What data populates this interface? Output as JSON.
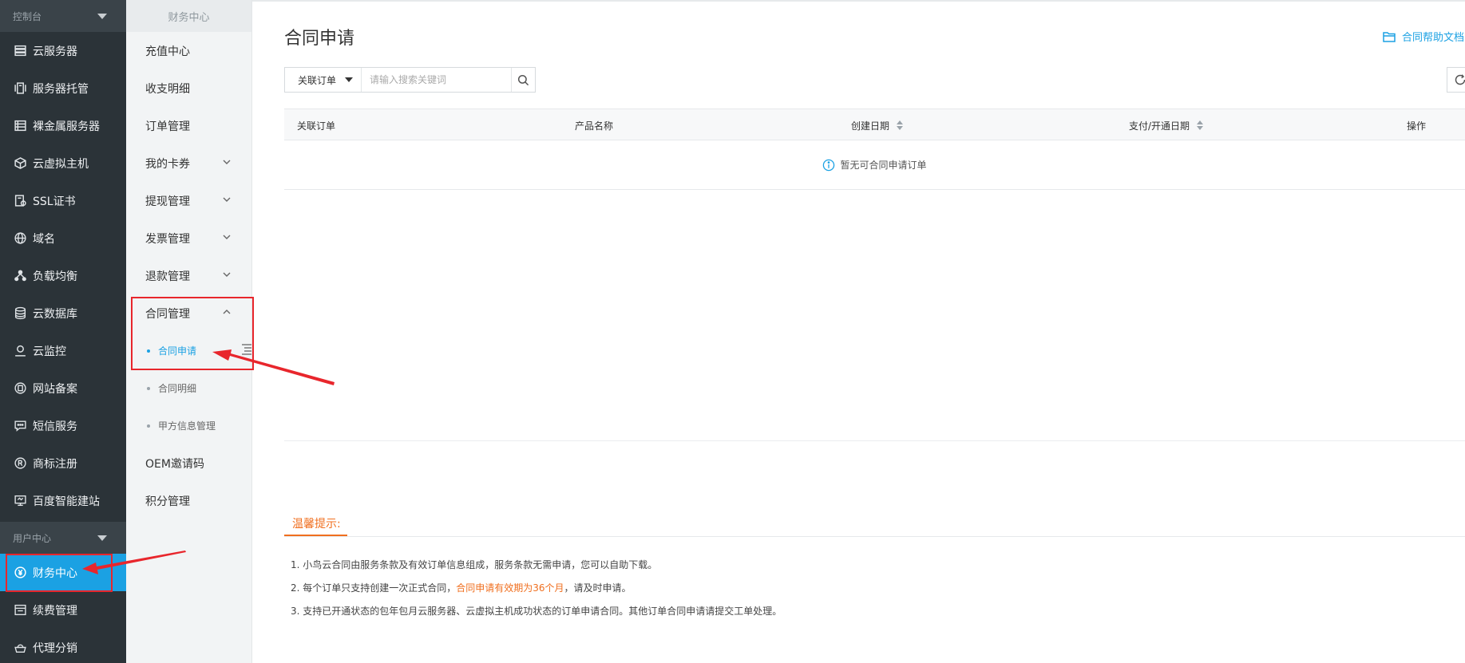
{
  "sidebar": {
    "console_label": "控制台",
    "items": [
      {
        "label": "云服务器",
        "icon": "server-list-icon"
      },
      {
        "label": "服务器托管",
        "icon": "hosting-icon"
      },
      {
        "label": "裸金属服务器",
        "icon": "bare-metal-icon"
      },
      {
        "label": "云虚拟主机",
        "icon": "cube-icon"
      },
      {
        "label": "SSL证书",
        "icon": "certificate-icon"
      },
      {
        "label": "域名",
        "icon": "globe-icon"
      },
      {
        "label": "负载均衡",
        "icon": "load-balance-icon"
      },
      {
        "label": "云数据库",
        "icon": "database-icon"
      },
      {
        "label": "云监控",
        "icon": "monitor-user-icon"
      },
      {
        "label": "网站备案",
        "icon": "record-icon"
      },
      {
        "label": "短信服务",
        "icon": "sms-icon"
      },
      {
        "label": "商标注册",
        "icon": "trademark-icon"
      },
      {
        "label": "百度智能建站",
        "icon": "site-builder-icon"
      }
    ],
    "user_center_label": "用户中心",
    "user_items": [
      {
        "label": "财务中心",
        "icon": "finance-icon",
        "active": true
      },
      {
        "label": "续费管理",
        "icon": "renew-icon"
      },
      {
        "label": "代理分销",
        "icon": "agent-icon"
      }
    ]
  },
  "subnav": {
    "title": "财务中心",
    "items": [
      {
        "label": "充值中心"
      },
      {
        "label": "收支明细"
      },
      {
        "label": "订单管理"
      },
      {
        "label": "我的卡券",
        "expandable": true
      },
      {
        "label": "提现管理",
        "expandable": true
      },
      {
        "label": "发票管理",
        "expandable": true
      },
      {
        "label": "退款管理",
        "expandable": true
      }
    ],
    "contract": {
      "label": "合同管理",
      "children": [
        {
          "label": "合同申请",
          "active": true
        },
        {
          "label": "合同明细"
        },
        {
          "label": "甲方信息管理"
        }
      ]
    },
    "tail_items": [
      {
        "label": "OEM邀请码"
      },
      {
        "label": "积分管理"
      }
    ]
  },
  "main": {
    "title": "合同申请",
    "help_link": "合同帮助文档",
    "search": {
      "select_value": "关联订单",
      "placeholder": "请输入搜索关键词"
    },
    "table": {
      "columns": [
        "关联订单",
        "产品名称",
        "创建日期",
        "支付/开通日期",
        "操作"
      ],
      "empty_text": "暂无可合同申请订单"
    },
    "tips": {
      "tab_label": "温馨提示:",
      "lines": [
        {
          "text": "1. 小鸟云合同由服务条款及有效订单信息组成，服务条款无需申请，您可以自助下载。"
        },
        {
          "before": "2. 每个订单只支持创建一次正式合同，",
          "highlight": "合同申请有效期为36个月",
          "after": "，请及时申请。"
        },
        {
          "text": "3. 支持已开通状态的包年包月云服务器、云虚拟主机成功状态的订单申请合同。其他订单合同申请请提交工单处理。"
        }
      ]
    }
  },
  "colors": {
    "sidebar_bg": "#2b3338",
    "active_blue": "#1ba1e3",
    "tip_orange": "#f06f1f",
    "annotation_red": "#e8262c"
  }
}
